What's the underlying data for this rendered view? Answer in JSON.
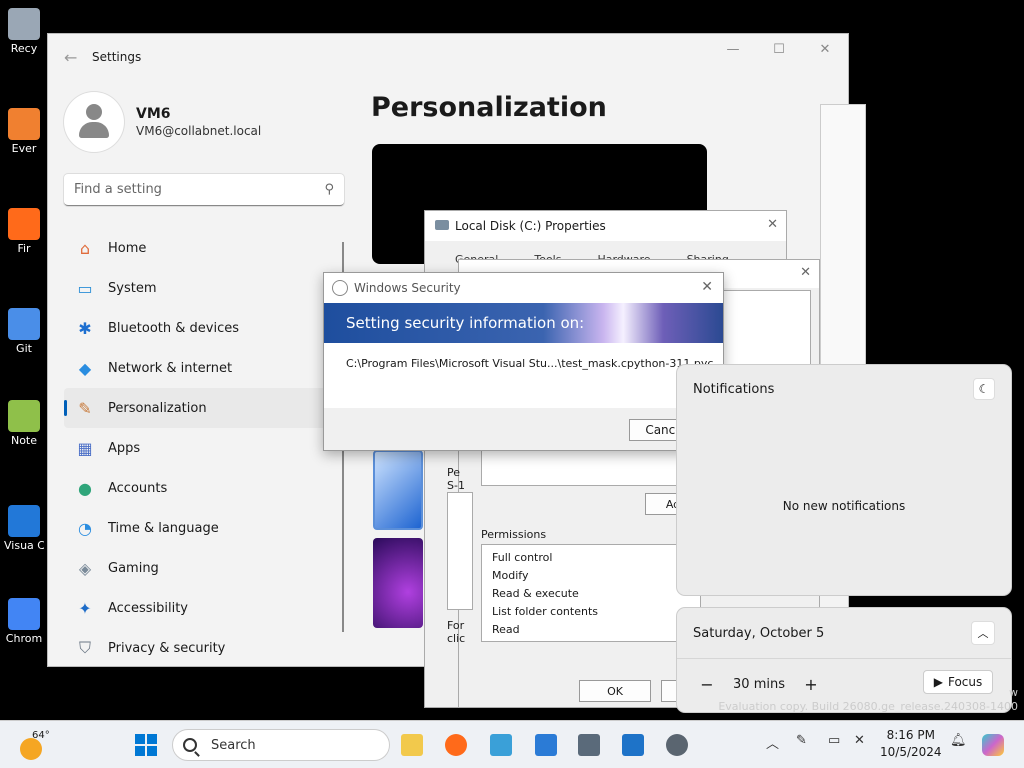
{
  "desktop": {
    "icons": [
      {
        "label": "Recy",
        "color": "#9aa7b5"
      },
      {
        "label": "Ever",
        "color": "#f08030"
      },
      {
        "label": "Fir",
        "color": "#ff6a1a"
      },
      {
        "label": "Git",
        "color": "#4a8ee8"
      },
      {
        "label": "Note",
        "color": "#8fc04a"
      },
      {
        "label": "Visua C",
        "color": "#2278d8"
      },
      {
        "label": "Chrom",
        "color": "#4285f4"
      }
    ]
  },
  "settings": {
    "title": "Settings",
    "user": {
      "name": "VM6",
      "email": "VM6@collabnet.local"
    },
    "search_placeholder": "Find a setting",
    "page_title": "Personalization",
    "nav": [
      {
        "label": "Home",
        "icon": "⌂",
        "color": "#e06c3c"
      },
      {
        "label": "System",
        "icon": "▭",
        "color": "#2b8fd6"
      },
      {
        "label": "Bluetooth & devices",
        "icon": "✱",
        "color": "#1d6fd0"
      },
      {
        "label": "Network & internet",
        "icon": "◆",
        "color": "#2a8de0"
      },
      {
        "label": "Personalization",
        "icon": "✎",
        "color": "#c87a3a"
      },
      {
        "label": "Apps",
        "icon": "▦",
        "color": "#4b6fc7"
      },
      {
        "label": "Accounts",
        "icon": "●",
        "color": "#2fa57a"
      },
      {
        "label": "Time & language",
        "icon": "◔",
        "color": "#2a8de0"
      },
      {
        "label": "Gaming",
        "icon": "◈",
        "color": "#7a8a99"
      },
      {
        "label": "Accessibility",
        "icon": "✦",
        "color": "#1e6cc8"
      },
      {
        "label": "Privacy & security",
        "icon": "⛉",
        "color": "#6b7785"
      }
    ]
  },
  "local_disk": {
    "title": "Local Disk (C:) Properties",
    "tabs": [
      "General",
      "Tools",
      "Hardware",
      "Sharing"
    ]
  },
  "advanced": {
    "frag1": "Pe",
    "frag2": "S-1",
    "frag3": "For",
    "frag4": "clic",
    "add_label": "Ad",
    "permissions_label": "Permissions",
    "permissions": [
      "Full control",
      "Modify",
      "Read & execute",
      "List folder contents",
      "Read"
    ],
    "ok_label": "OK"
  },
  "windows_security": {
    "title": "Windows Security",
    "banner": "Setting security information on:",
    "path": "C:\\Program Files\\Microsoft Visual Stu...\\test_mask.cpython-311.pyc",
    "cancel_label": "Cance"
  },
  "notifications": {
    "title": "Notifications",
    "empty_text": "No new notifications"
  },
  "calendar": {
    "date": "Saturday, October 5",
    "minutes": "30 mins",
    "focus_label": "Focus"
  },
  "watermark": {
    "line1": "w",
    "line2": "Evaluation copy. Build 26080.ge_release.240308-1400"
  },
  "taskbar": {
    "temperature": "64°",
    "search_label": "Search",
    "time": "8:16 PM",
    "date": "10/5/2024",
    "apps": [
      {
        "name": "file-explorer-icon",
        "color": "#f2c94c"
      },
      {
        "name": "firefox-icon",
        "color": "#ff6a1a"
      },
      {
        "name": "notepad-icon",
        "color": "#3aa0d8"
      },
      {
        "name": "network-app-icon",
        "color": "#2b7bd6"
      },
      {
        "name": "server-icon",
        "color": "#5a6a7a"
      },
      {
        "name": "monitor-icon",
        "color": "#1e73c8"
      },
      {
        "name": "settings-gear-icon",
        "color": "#5a6570"
      }
    ]
  }
}
